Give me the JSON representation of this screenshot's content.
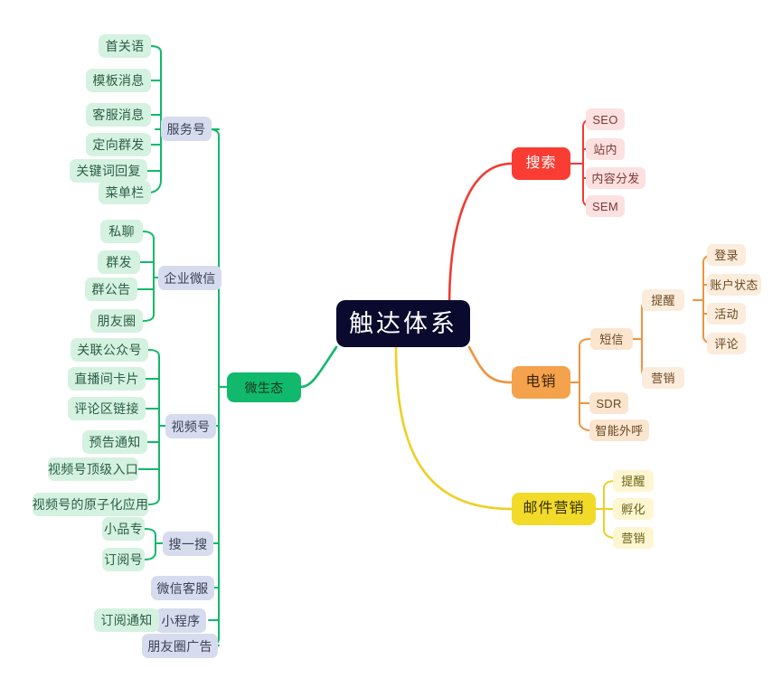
{
  "diagram": {
    "type": "mind-map",
    "title": "触达体系",
    "background": "#ffffff",
    "root": {
      "label": "触达体系",
      "color": "#0a0a2e",
      "text_color": "#ffffff"
    },
    "branches": [
      {
        "id": "wechat",
        "label": "微生态",
        "color": "#10b96b",
        "edge_color": "#10b96b",
        "side": "left",
        "children": [
          {
            "label": "服务号",
            "children": [
              "首关语",
              "模板消息",
              "客服消息",
              "定向群发",
              "关键词回复",
              "菜单栏"
            ]
          },
          {
            "label": "企业微信",
            "children": [
              "私聊",
              "群发",
              "群公告",
              "朋友圈"
            ]
          },
          {
            "label": "视频号",
            "children": [
              "关联公众号",
              "直播间卡片",
              "评论区链接",
              "预告通知",
              "视频号顶级入口",
              "视频号的原子化应用"
            ]
          },
          {
            "label": "搜一搜",
            "children": [
              "小品专",
              "订阅号"
            ]
          },
          {
            "label": "微信客服",
            "children": []
          },
          {
            "label": "小程序",
            "children": [
              "订阅通知"
            ]
          },
          {
            "label": "朋友圈广告",
            "children": []
          }
        ]
      },
      {
        "id": "search",
        "label": "搜索",
        "color": "#fa3c32",
        "edge_color": "#ef3b30",
        "side": "right",
        "children": [
          {
            "label": "SEO",
            "children": []
          },
          {
            "label": "站内",
            "children": []
          },
          {
            "label": "内容分发",
            "children": []
          },
          {
            "label": "SEM",
            "children": []
          }
        ]
      },
      {
        "id": "telesales",
        "label": "电销",
        "color": "#f5a24d",
        "edge_color": "#f0933f",
        "side": "right",
        "children": [
          {
            "label": "短信",
            "children": [
              {
                "label": "提醒",
                "children": [
                  "登录",
                  "账户状态",
                  "活动",
                  "评论"
                ]
              },
              {
                "label": "营销",
                "children": []
              }
            ]
          },
          {
            "label": "SDR",
            "children": []
          },
          {
            "label": "智能外呼",
            "children": []
          }
        ]
      },
      {
        "id": "email",
        "label": "邮件营销",
        "color": "#f2da28",
        "edge_color": "#ecd026",
        "side": "right",
        "children": [
          {
            "label": "提醒",
            "children": []
          },
          {
            "label": "孵化",
            "children": []
          },
          {
            "label": "营销",
            "children": []
          }
        ]
      }
    ]
  },
  "nodes": {
    "root": "触达体系",
    "weishengtai": "微生态",
    "fuwuhao": "服务号",
    "fuwuhao_1": "首关语",
    "fuwuhao_2": "模板消息",
    "fuwuhao_3": "客服消息",
    "fuwuhao_4": "定向群发",
    "fuwuhao_5": "关键词回复",
    "fuwuhao_6": "菜单栏",
    "qiyeweixin": "企业微信",
    "qiyeweixin_1": "私聊",
    "qiyeweixin_2": "群发",
    "qiyeweixin_3": "群公告",
    "qiyeweixin_4": "朋友圈",
    "shipinhao": "视频号",
    "shipinhao_1": "关联公众号",
    "shipinhao_2": "直播间卡片",
    "shipinhao_3": "评论区链接",
    "shipinhao_4": "预告通知",
    "shipinhao_5": "视频号顶级入口",
    "shipinhao_6": "视频号的原子化应用",
    "souyisou": "搜一搜",
    "souyisou_1": "小品专",
    "souyisou_2": "订阅号",
    "weixinkefu": "微信客服",
    "xiaochengxu": "小程序",
    "xiaochengxu_1": "订阅通知",
    "pengyouquanguanggao": "朋友圈广告",
    "sousuo": "搜索",
    "sousuo_1": "SEO",
    "sousuo_2": "站内",
    "sousuo_3": "内容分发",
    "sousuo_4": "SEM",
    "dianxiao": "电销",
    "duanxin": "短信",
    "tixing": "提醒",
    "tixing_1": "登录",
    "tixing_2": "账户状态",
    "tixing_3": "活动",
    "tixing_4": "评论",
    "yingxiao": "营销",
    "sdr": "SDR",
    "zhinengwaihu": "智能外呼",
    "youjianyingxiao": "邮件营销",
    "youjian_1": "提醒",
    "youjian_2": "孵化",
    "youjian_3": "营销"
  }
}
